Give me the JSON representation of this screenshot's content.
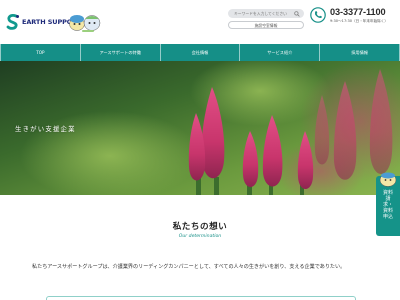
{
  "header": {
    "logo_text": "EARTH SUPPORT",
    "search_placeholder": "キーワードを入力してください",
    "site_button": "施設空室情報",
    "phone_number": "03-3377-1100",
    "phone_hours": "9:30～17:30（日・年末年始除く）"
  },
  "nav": {
    "items": [
      {
        "label": "TOP"
      },
      {
        "label": "アースサポートの特徴"
      },
      {
        "label": "会社情報"
      },
      {
        "label": "サービス紹介"
      },
      {
        "label": "採用情報"
      }
    ]
  },
  "hero": {
    "caption": "生きがい支援企業"
  },
  "side_tab": {
    "text": "資料請求・資料申込"
  },
  "about": {
    "title": "私たちの想い",
    "subtitle": "Our determination",
    "body": "私たちアースサポートグループは、介護業界のリーディングカンパニーとして、すべての人々の生きがいを創り、支える企業であり​たい。"
  },
  "colors": {
    "brand_teal": "#158f87",
    "logo_navy": "#1e2a7a"
  }
}
